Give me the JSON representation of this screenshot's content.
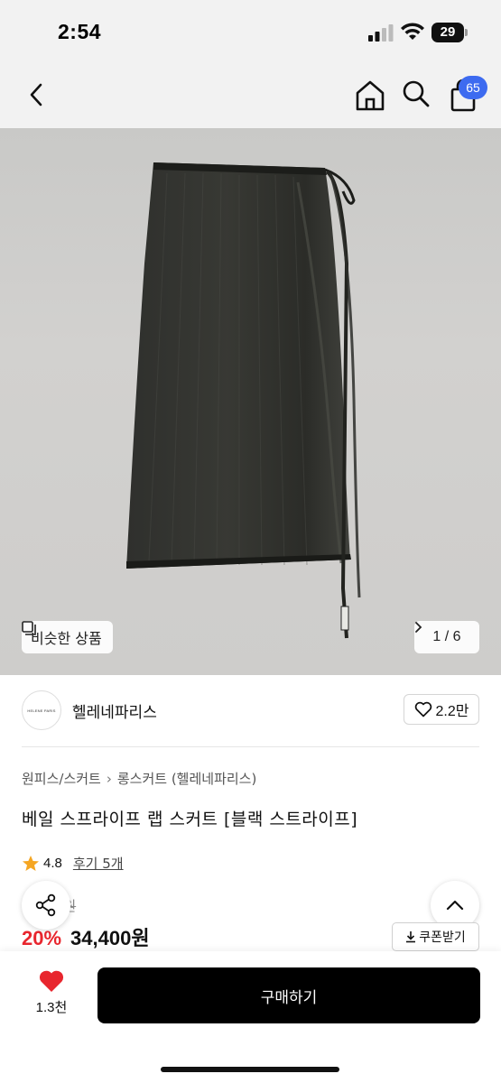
{
  "status_bar": {
    "time": "2:54",
    "battery": "29",
    "icons": [
      "signal-icon",
      "wifi-icon",
      "battery-icon"
    ]
  },
  "nav": {
    "icons": [
      "back-icon",
      "home-icon",
      "search-icon",
      "cart-icon"
    ],
    "cart_count": "65",
    "badge_color": "#3d6bf0"
  },
  "product_image": {
    "similar_label": "비슷한 상품",
    "page_current": "1",
    "page_total": "6",
    "page_text": "1 / 6"
  },
  "store": {
    "logo_text": "HELENE PARIS",
    "name": "헬레네파리스",
    "likes": "2.2만"
  },
  "breadcrumb": [
    "원피스/스커트",
    "롱스커트 (헬레네파리스)"
  ],
  "product": {
    "title": "베일 스프라이프 랩 스커트 [블랙 스트라이프]",
    "rating": "4.8",
    "review_link": "후기 5개",
    "original_price_visible": "9원",
    "discount": "20%",
    "sale_price": "34,400원"
  },
  "coupon_label": "쿠폰받기",
  "bottom_bar": {
    "wish_count": "1.3천",
    "buy_label": "구매하기"
  },
  "colors": {
    "accent_red": "#e8262e",
    "heart_red": "#e8262e",
    "star": "#f5a623"
  }
}
